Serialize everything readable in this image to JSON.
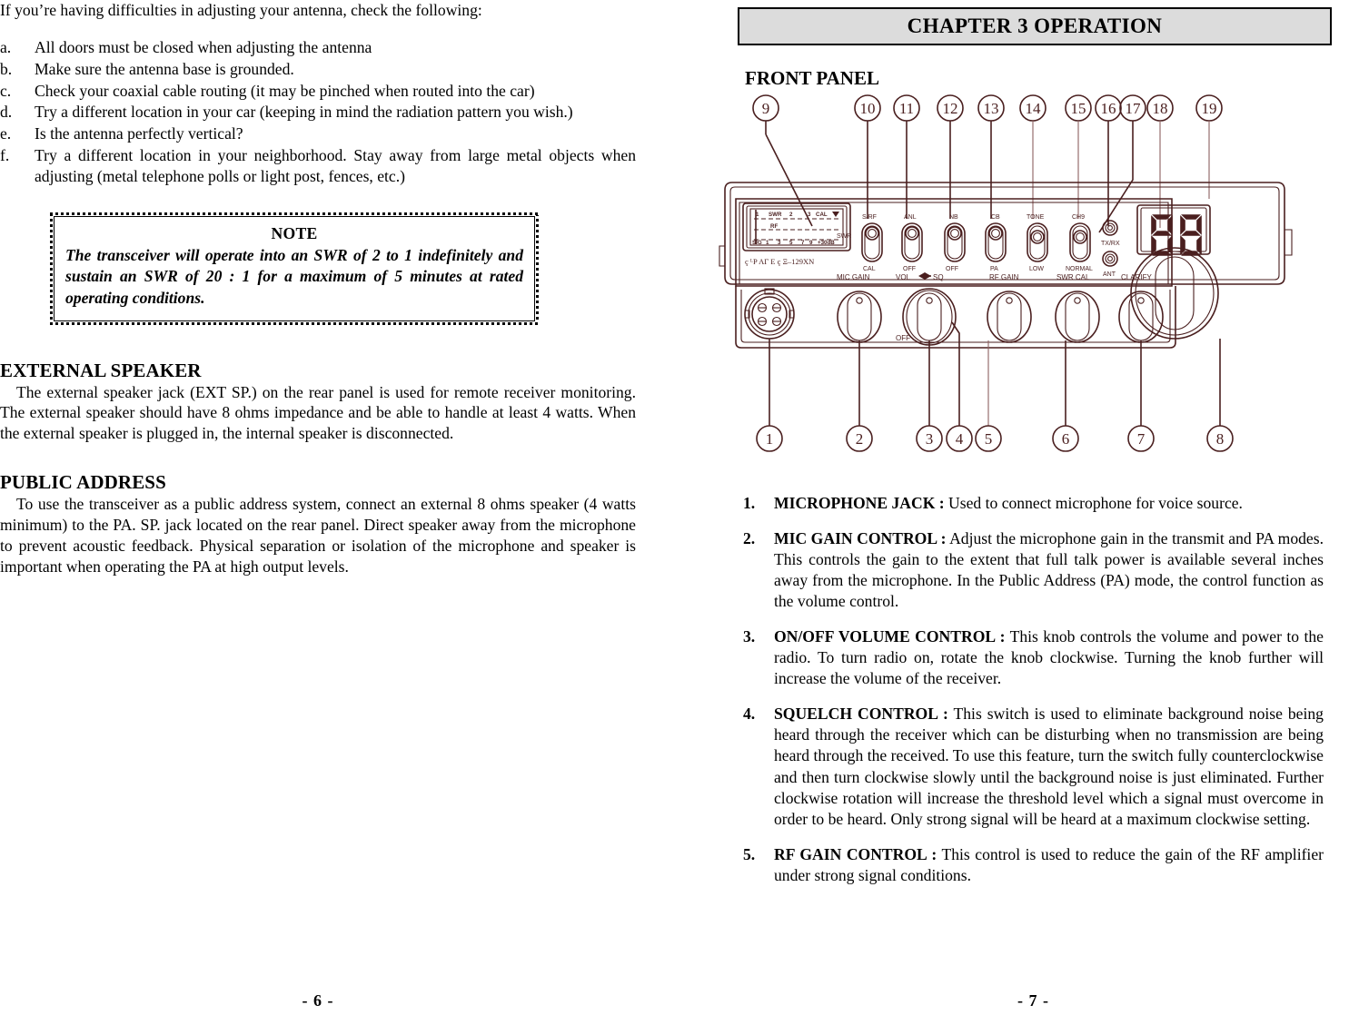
{
  "colors": {
    "diagram_line": "#4a1f1f",
    "diagram_line_light": "#8c6060",
    "banner_bg": "#dcdcdc",
    "text": "#000000"
  },
  "left_page": {
    "intro": "If you’re having difficulties in adjusting your antenna, check the following:",
    "checklist": [
      {
        "marker": "a.",
        "text": "All doors must be closed when adjusting the antenna"
      },
      {
        "marker": "b.",
        "text": "Make sure the antenna base is grounded."
      },
      {
        "marker": "c.",
        "text": "Check your coaxial cable routing (it may be pinched when routed into the car)"
      },
      {
        "marker": "d.",
        "text": "Try a different location in your car (keeping in mind the radiation pattern you wish.)"
      },
      {
        "marker": "e.",
        "text": "Is the antenna perfectly vertical?"
      },
      {
        "marker": "f.",
        "text": "Try a different location in your neighborhood. Stay away from large metal objects when adjusting (metal telephone polls or light post, fences, etc.)"
      }
    ],
    "note": {
      "title": "NOTE",
      "body": "The transceiver will operate into an SWR of 2 to 1 indefinitely and sustain an SWR of 20 : 1 for a maximum of 5 minutes at rated operating conditions."
    },
    "sections": [
      {
        "heading": "EXTERNAL SPEAKER",
        "body": "The external speaker jack (EXT SP.) on the rear panel is used for remote receiver monitoring. The external speaker should have 8 ohms impedance and be able to handle at least 4 watts. When the external speaker is plugged in, the internal speaker is disconnected."
      },
      {
        "heading": "PUBLIC ADDRESS",
        "body": "To use the transceiver as a public address system, connect an external 8 ohms speaker (4 watts minimum) to the PA. SP. jack located on the rear panel. Direct speaker away from the microphone to prevent acoustic feedback. Physical separation or isolation of the microphone and speaker is important when operating the PA at high output levels."
      }
    ],
    "page_number": "- 6 -"
  },
  "right_page": {
    "chapter_banner": "CHAPTER 3 OPERATION",
    "front_panel_heading": "FRONT PANEL",
    "diagram": {
      "top_callouts": [
        "9",
        "10",
        "11",
        "12",
        "13",
        "14",
        "15",
        "16",
        "17",
        "18",
        "19"
      ],
      "bottom_callouts": [
        "1",
        "2",
        "3",
        "4",
        "5",
        "6",
        "7",
        "8"
      ],
      "meter": {
        "swr_row": [
          "1",
          "SWR",
          "2",
          "3",
          "CAL"
        ],
        "rf_label": "RF",
        "sig_row": [
          "SIG",
          "1",
          "3",
          "5",
          "7",
          "9",
          "+30dB"
        ],
        "brand_text": "ç ᴸP AΓ E  ç Ξ–129XN"
      },
      "switches": [
        {
          "top": "S/RF",
          "side": "SWR",
          "bottom": "CAL"
        },
        {
          "top": "ANL",
          "side": "",
          "bottom": "OFF"
        },
        {
          "top": "NB",
          "side": "",
          "bottom": "OFF"
        },
        {
          "top": "CB",
          "side": "",
          "bottom": "PA"
        },
        {
          "top": "TONE",
          "side": "",
          "bottom": "LOW"
        },
        {
          "top": "CH9",
          "side": "",
          "bottom": "NORMAL"
        }
      ],
      "indicators": [
        {
          "label": "TX/RX"
        },
        {
          "label": "ANT"
        }
      ],
      "knobs": [
        {
          "label": "MIC GAIN",
          "sub": ""
        },
        {
          "label": "VOL",
          "label2": "SQ",
          "sub": "OFF"
        },
        {
          "label": "RF GAIN",
          "sub": ""
        },
        {
          "label": "SWR CAL",
          "sub": ""
        },
        {
          "label": "CLARIFY",
          "sub": ""
        }
      ],
      "display_value": "88"
    },
    "items": [
      {
        "num": "1.",
        "title": "MICROPHONE JACK :",
        "text": " Used to connect microphone for voice source."
      },
      {
        "num": "2.",
        "title": "MIC GAIN CONTROL :",
        "text": " Adjust the microphone gain in the transmit and PA modes. This controls the gain to the extent that full talk power is available several inches away from the microphone. In the Public Address (PA) mode, the control function as the volume control."
      },
      {
        "num": "3.",
        "title": "ON/OFF VOLUME CONTROL :",
        "text": " This knob controls the volume and power to the radio. To turn radio on, rotate the knob clockwise. Turning the knob further will increase the volume of the receiver."
      },
      {
        "num": "4.",
        "title": "SQUELCH CONTROL :",
        "text": " This switch is used to eliminate background noise being heard through the receiver which can be disturbing when no transmission are being heard through the received. To use this feature, turn the switch fully counterclockwise and then turn clockwise slowly until the background noise is just eliminated. Further clockwise rotation will increase the threshold level which a signal must overcome in order to be heard. Only strong signal will be heard at a maximum clockwise setting."
      },
      {
        "num": "5.",
        "title": "RF GAIN CONTROL :",
        "text": " This control is used to reduce the gain of the RF amplifier under strong signal conditions."
      }
    ],
    "page_number": "- 7 -"
  }
}
